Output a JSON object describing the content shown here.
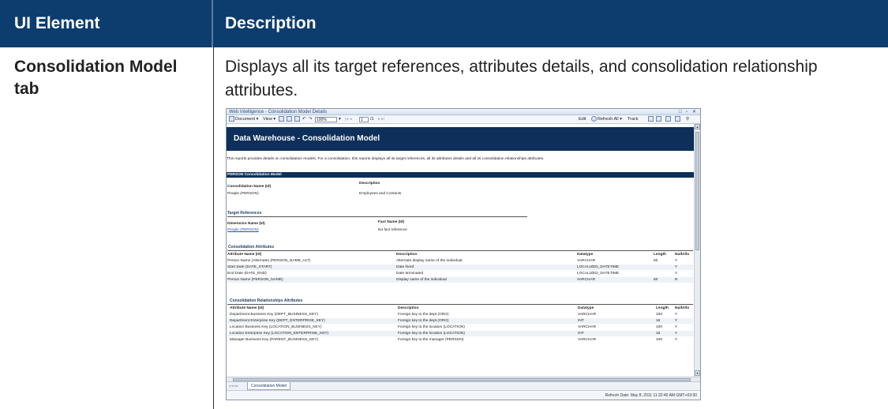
{
  "header": {
    "col1": "UI Element",
    "col2": "Description"
  },
  "row": {
    "element_name": "Consolidation Model tab",
    "description": "Displays all its target references, attributes details, and consolidation relationship attributes."
  },
  "screenshot": {
    "window_title": "Web Intelligence - Consolidation Model Details",
    "window_controls": "□ ▫ ✕",
    "toolbar": {
      "document": "Document ▾",
      "view": "View ▾",
      "zoom": "100%",
      "page": "1",
      "page_of": "/1",
      "edit": "Edit",
      "refresh": "Refresh All ▾",
      "track": "Track"
    },
    "report_title": "Data Warehouse - Consolidation Model",
    "intro": "This reports provides details on consolidation models. For a consolidation, this reports displays all its target references, all its attributes details and all its consolidation relationships attributes.",
    "section_bar": "PERSON Consolidation Model",
    "model": {
      "name_header": "Consolidation Name (Id)",
      "desc_header": "Description",
      "name": "People (PERSON)",
      "desc": "Employees and Contacts"
    },
    "target_refs": {
      "title": "Target References",
      "dim_header": "Dimension Name (Id)",
      "fact_header": "Fact Name (Id)",
      "dim": "People (PERSON)",
      "fact": "No fact reference"
    },
    "attributes": {
      "title": "Consolidation Attributes",
      "headers": [
        "Attribute Name (Id)",
        "Description",
        "Datatype",
        "Length",
        "NullAllo"
      ],
      "rows": [
        [
          "Person Name (Alternate) (PERSON_NAME_ALT)",
          "Alternate display name of the individual",
          "VARCHAR",
          "60",
          "Y"
        ],
        [
          "Start Date (DATE_START)",
          "Date hired",
          "LOCALIZED_DATETIME",
          "",
          "Y"
        ],
        [
          "End Date (DATE_END)",
          "Date terminated",
          "LOCALIZED_DATETIME",
          "",
          "Y"
        ],
        [
          "Person Name (PERSON_NAME)",
          "Display name of the individual",
          "VARCHAR",
          "60",
          "N"
        ]
      ]
    },
    "relationships": {
      "title": "Consolidation Relationships Attributes",
      "headers": [
        "Attribute Name (Id)",
        "Description",
        "Datatype",
        "Length",
        "NullAllo"
      ],
      "rows": [
        [
          "Department Business Key (DEPT_BUSINESS_KEY)",
          "Foreign key to the dept (ORG)",
          "VARCHAR",
          "100",
          "Y"
        ],
        [
          "Department Enterprise Key (DEPT_ENTERPRISE_KEY)",
          "Foreign key to the dept (ORG)",
          "INT",
          "16",
          "Y"
        ],
        [
          "Location Business Key (LOCATION_BUSINESS_KEY)",
          "Foreign key to the location (LOCATION)",
          "VARCHAR",
          "100",
          "Y"
        ],
        [
          "Location Enterprise Key (LOCATION_ENTERPRISE_KEY)",
          "Foreign key to the location (LOCATION)",
          "INT",
          "16",
          "Y"
        ],
        [
          "Manager Business Key (PARENT_BUSINESS_KEY)",
          "Foreign key to the manager (PERSON)",
          "VARCHAR",
          "100",
          "Y"
        ]
      ]
    },
    "tab_label": "Consolidation Model",
    "status": "Refresh Date: May 8, 2011 11:22:40 AM GMT+03:00"
  }
}
